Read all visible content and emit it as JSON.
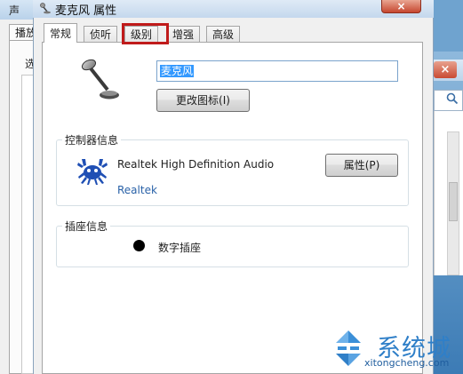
{
  "background_window": {
    "title": "声",
    "tab_label": "播放",
    "select_text": "选"
  },
  "right_window": {
    "close_symbol": "×",
    "search_icon": "search-icon"
  },
  "dialog": {
    "title": "麦克风 属性",
    "close_symbol": "×",
    "tabs": [
      {
        "label": "常规",
        "active": true
      },
      {
        "label": "侦听",
        "active": false
      },
      {
        "label": "级别",
        "active": false,
        "highlighted": true
      },
      {
        "label": "增强",
        "active": false
      },
      {
        "label": "高级",
        "active": false
      }
    ],
    "highlight_color": "#c01b1b"
  },
  "general": {
    "device_name_value": "麦克风",
    "change_icon_button": "更改图标(I)",
    "controller": {
      "group_label": "控制器信息",
      "name": "Realtek High Definition Audio",
      "vendor": "Realtek",
      "properties_button": "属性(P)"
    },
    "jack": {
      "group_label": "插座信息",
      "label": "数字插座"
    }
  },
  "watermark": {
    "text_cn": "系统城",
    "text_en": "xitongcheng.com"
  }
}
